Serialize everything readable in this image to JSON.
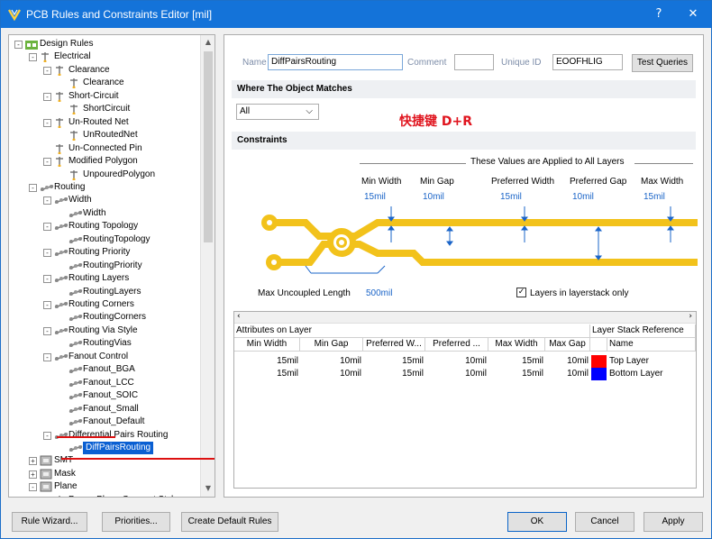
{
  "window": {
    "title": "PCB Rules and Constraints Editor [mil]",
    "help_label": "?",
    "close_label": "✕"
  },
  "tree": {
    "items": [
      {
        "label": "Design Rules",
        "icon": "design-rules-folder-icon"
      },
      {
        "label": "Electrical",
        "icon": "rule-category-icon"
      },
      {
        "label": "Clearance",
        "icon": "rule-type-icon"
      },
      {
        "label": "Clearance",
        "icon": "rule-icon"
      },
      {
        "label": "Short-Circuit",
        "icon": "rule-type-icon"
      },
      {
        "label": "ShortCircuit",
        "icon": "rule-icon"
      },
      {
        "label": "Un-Routed Net",
        "icon": "rule-type-icon"
      },
      {
        "label": "UnRoutedNet",
        "icon": "rule-icon"
      },
      {
        "label": "Un-Connected Pin",
        "icon": "rule-type-icon"
      },
      {
        "label": "Modified Polygon",
        "icon": "rule-type-icon"
      },
      {
        "label": "UnpouredPolygon",
        "icon": "rule-icon"
      },
      {
        "label": "Routing",
        "icon": "routing-category-icon"
      },
      {
        "label": "Width",
        "icon": "routing-type-icon"
      },
      {
        "label": "Width",
        "icon": "routing-rule-icon"
      },
      {
        "label": "Routing Topology",
        "icon": "routing-type-icon"
      },
      {
        "label": "RoutingTopology",
        "icon": "routing-rule-icon"
      },
      {
        "label": "Routing Priority",
        "icon": "routing-type-icon"
      },
      {
        "label": "RoutingPriority",
        "icon": "routing-rule-icon"
      },
      {
        "label": "Routing Layers",
        "icon": "routing-type-icon"
      },
      {
        "label": "RoutingLayers",
        "icon": "routing-rule-icon"
      },
      {
        "label": "Routing Corners",
        "icon": "routing-type-icon"
      },
      {
        "label": "RoutingCorners",
        "icon": "routing-rule-icon"
      },
      {
        "label": "Routing Via Style",
        "icon": "routing-type-icon"
      },
      {
        "label": "RoutingVias",
        "icon": "routing-rule-icon"
      },
      {
        "label": "Fanout Control",
        "icon": "routing-type-icon"
      },
      {
        "label": "Fanout_BGA",
        "icon": "routing-rule-icon"
      },
      {
        "label": "Fanout_LCC",
        "icon": "routing-rule-icon"
      },
      {
        "label": "Fanout_SOIC",
        "icon": "routing-rule-icon"
      },
      {
        "label": "Fanout_Small",
        "icon": "routing-rule-icon"
      },
      {
        "label": "Fanout_Default",
        "icon": "routing-rule-icon"
      },
      {
        "label": "Differential Pairs Routing",
        "icon": "routing-type-icon"
      },
      {
        "label": "DiffPairsRouting",
        "icon": "routing-rule-icon"
      },
      {
        "label": "SMT",
        "icon": "smt-category-icon"
      },
      {
        "label": "Mask",
        "icon": "mask-category-icon"
      },
      {
        "label": "Plane",
        "icon": "plane-category-icon"
      },
      {
        "label": "Power Plane Connect Style",
        "icon": "rule-type-icon"
      }
    ]
  },
  "header": {
    "name_label": "Name",
    "name_value": "DiffPairsRouting",
    "comment_label": "Comment",
    "comment_value": "",
    "uid_label": "Unique ID",
    "uid_value": "EOOFHLIG",
    "test_queries_label": "Test Queries"
  },
  "where": {
    "heading": "Where The Object Matches",
    "dropdown_value": "All",
    "annotation": "快捷键 D+R"
  },
  "constraints": {
    "heading": "Constraints",
    "applied_note": "These Values are Applied to All Layers",
    "params": [
      {
        "label": "Min Width",
        "value": "15mil"
      },
      {
        "label": "Min Gap",
        "value": "10mil"
      },
      {
        "label": "Preferred Width",
        "value": "15mil"
      },
      {
        "label": "Preferred Gap",
        "value": "10mil"
      },
      {
        "label": "Max Width",
        "value": "15mil"
      }
    ],
    "max_uncoupled_label": "Max Uncoupled Length",
    "max_uncoupled_value": "500mil",
    "layers_only_label": "Layers in layerstack only",
    "layers_only_checked": true
  },
  "grid": {
    "group_left": "Attributes on Layer",
    "group_right": "Layer Stack Reference",
    "columns": [
      "Min Width",
      "Min Gap",
      "Preferred W...",
      "Preferred ...",
      "Max Width",
      "Max Gap",
      "Name"
    ],
    "rows": [
      {
        "min_width": "15mil",
        "min_gap": "10mil",
        "pref_width": "15mil",
        "pref_gap": "10mil",
        "max_width": "15mil",
        "max_gap": "10mil",
        "name": "Top Layer",
        "color": "#ff0000"
      },
      {
        "min_width": "15mil",
        "min_gap": "10mil",
        "pref_width": "15mil",
        "pref_gap": "10mil",
        "max_width": "15mil",
        "max_gap": "10mil",
        "name": "Bottom Layer",
        "color": "#0000ff"
      }
    ]
  },
  "footer": {
    "rule_wizard": "Rule Wizard...",
    "priorities": "Priorities...",
    "create_default": "Create Default Rules",
    "ok": "OK",
    "cancel": "Cancel",
    "apply": "Apply"
  },
  "colors": {
    "accent": "#1473d9",
    "trace": "#f2c21b",
    "annotation": "#e0141e"
  }
}
